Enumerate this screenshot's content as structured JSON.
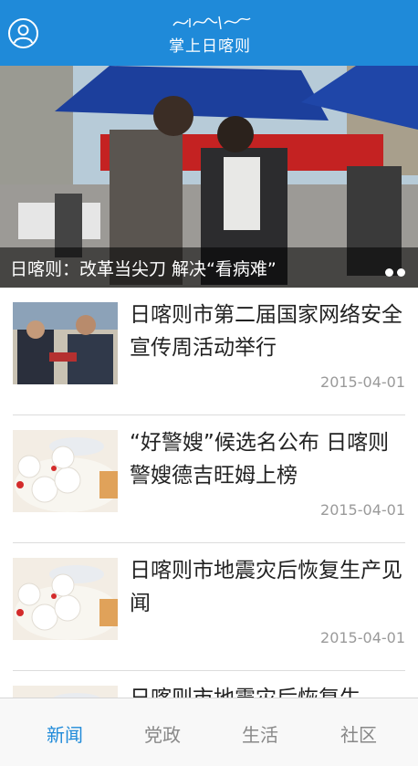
{
  "header": {
    "logo_script": "ᠵᠢᠭᠠᠵᠠ",
    "logo_text": "掌上日喀则",
    "user_icon": "user-circle-icon"
  },
  "banner": {
    "title": "日喀则：改革当尖刀 解决“看病难”",
    "slide_count": 2
  },
  "news": [
    {
      "title": "日喀则市第二届国家网络安全宣传周活动举行",
      "date": "2015-04-01"
    },
    {
      "title": "“好警嫂”候选名公布 日喀则警嫂德吉旺姆上榜",
      "date": "2015-04-01"
    },
    {
      "title": "日喀则市地震灾后恢复生产见闻",
      "date": "2015-04-01"
    },
    {
      "title": "日喀则市地震灾后恢复生",
      "date": ""
    }
  ],
  "tabs": [
    {
      "label": "新闻",
      "active": true
    },
    {
      "label": "党政",
      "active": false
    },
    {
      "label": "生活",
      "active": false
    },
    {
      "label": "社区",
      "active": false
    }
  ],
  "colors": {
    "accent": "#1f8ad9",
    "tab_inactive": "#888888"
  }
}
